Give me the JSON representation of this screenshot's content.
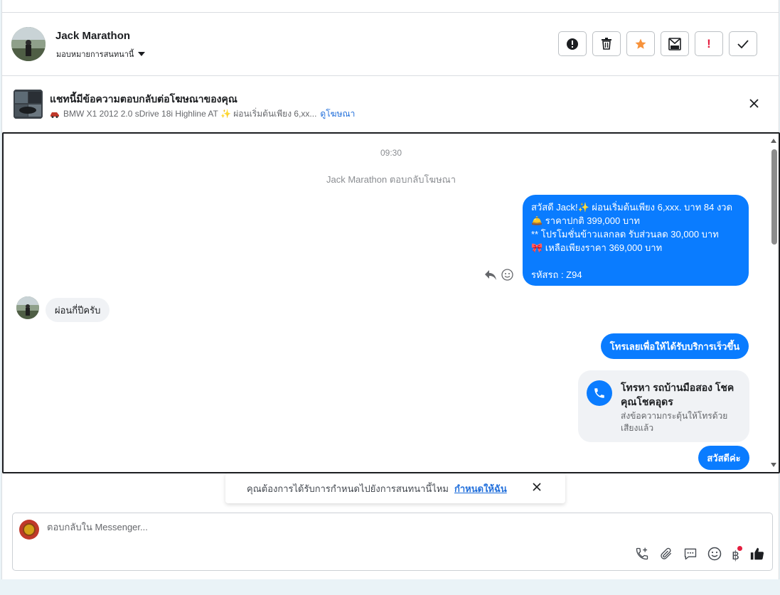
{
  "header": {
    "name": "Jack Marathon",
    "assign_label": "มอบหมายการสนทนานี้"
  },
  "actions": [
    {
      "name": "report-button",
      "icon": "alert-circle-icon"
    },
    {
      "name": "delete-button",
      "icon": "trash-icon"
    },
    {
      "name": "star-button",
      "icon": "star-icon"
    },
    {
      "name": "mark-unread-button",
      "icon": "envelope-icon"
    },
    {
      "name": "important-button",
      "icon": "exclamation-icon"
    },
    {
      "name": "done-button",
      "icon": "check-icon"
    }
  ],
  "ad": {
    "title": "แชทนี้มีข้อความตอบกลับต่อโฆษณาของคุณ",
    "subtitle": "BMW X1 2012 2.0 sDrive 18i Highline AT ✨ ผ่อนเริ่มต้นเพียง 6,xx...",
    "link": "ดูโฆษณา"
  },
  "chat": {
    "time": "09:30",
    "system_note": "Jack Marathon ตอบกลับโฆษณา",
    "outgoing_1": [
      "สวัสดี Jack!✨  ผ่อนเริ่มต้นเพียง 6,xxx. บาท 84 งวด",
      "🛎️ ราคาปกติ 399,000 บาท",
      "** โปรโมชั่นข้าวแลกลด รับส่วนลด 30,000 บาท",
      "🎀  เหลือเพียงราคา 369,000 บาท",
      "",
      "รหัสรถ : Z94"
    ],
    "incoming_1": "ผ่อนกี่ปีครับ",
    "outgoing_2": "โทรเลยเพื่อให้ได้รับบริการเร็วขึ้น",
    "call_card": {
      "title": "โทรหา รถบ้านมือสอง โชคคุณโชคอุดร",
      "subtitle": "ส่งข้อความกระตุ้นให้โทรด้วยเสียงแล้ว"
    },
    "outgoing_3": "สวัสดีค่ะ"
  },
  "toast": {
    "text": "คุณต้องการได้รับการกำหนดไปยังการสนทนานี้ไหม",
    "link": "กำหนดให้ฉัน"
  },
  "composer": {
    "placeholder": "ตอบกลับใน Messenger...",
    "baht_symbol": "฿"
  },
  "colors": {
    "accent": "#0a7cff",
    "star": "#f7923a",
    "danger": "#e41e3f"
  }
}
